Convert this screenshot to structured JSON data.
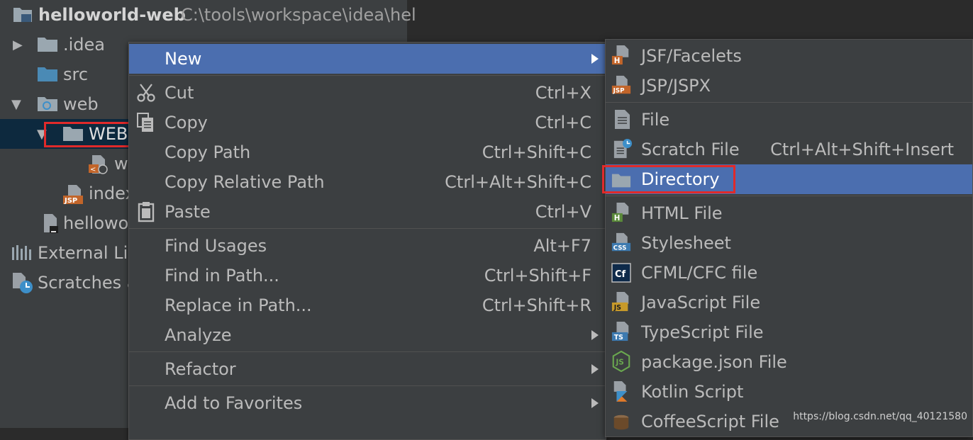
{
  "project_tree": {
    "title": "helloworld-web",
    "path": "C:\\tools\\workspace\\idea\\hel",
    "items": [
      {
        "label": ".idea"
      },
      {
        "label": "src"
      },
      {
        "label": "web"
      },
      {
        "label": "WEB-"
      },
      {
        "label": "w"
      },
      {
        "label": "index"
      },
      {
        "label": "hellowo"
      },
      {
        "label": "External Lib"
      },
      {
        "label": "Scratches a"
      }
    ]
  },
  "context_menu": {
    "items": [
      {
        "label": "New",
        "shortcut": ""
      },
      {
        "label": "Cut",
        "shortcut": "Ctrl+X"
      },
      {
        "label": "Copy",
        "shortcut": "Ctrl+C"
      },
      {
        "label": "Copy Path",
        "shortcut": "Ctrl+Shift+C"
      },
      {
        "label": "Copy Relative Path",
        "shortcut": "Ctrl+Alt+Shift+C"
      },
      {
        "label": "Paste",
        "shortcut": "Ctrl+V"
      },
      {
        "label": "Find Usages",
        "shortcut": "Alt+F7"
      },
      {
        "label": "Find in Path...",
        "shortcut": "Ctrl+Shift+F"
      },
      {
        "label": "Replace in Path...",
        "shortcut": "Ctrl+Shift+R"
      },
      {
        "label": "Analyze",
        "shortcut": ""
      },
      {
        "label": "Refactor",
        "shortcut": ""
      },
      {
        "label": "Add to Favorites",
        "shortcut": ""
      }
    ]
  },
  "new_submenu": {
    "items": [
      {
        "label": "JSF/Facelets",
        "badge": "H"
      },
      {
        "label": "JSP/JSPX",
        "badge": "JSP"
      },
      {
        "label": "File",
        "shortcut": ""
      },
      {
        "label": "Scratch File",
        "shortcut": "Ctrl+Alt+Shift+Insert"
      },
      {
        "label": "Directory",
        "shortcut": ""
      },
      {
        "label": "HTML File",
        "badge": "H"
      },
      {
        "label": "Stylesheet",
        "badge": "CSS"
      },
      {
        "label": "CFML/CFC file",
        "badge": "Cf"
      },
      {
        "label": "JavaScript File",
        "badge": "JS"
      },
      {
        "label": "TypeScript File",
        "badge": "TS"
      },
      {
        "label": "package.json File",
        "badge": "JS"
      },
      {
        "label": "Kotlin Script",
        "badge": ""
      },
      {
        "label": "CoffeeScript File",
        "badge": ""
      }
    ]
  },
  "watermark": "https://blog.csdn.net/qq_40121580",
  "colors": {
    "highlight": "#4b6eaf",
    "panel": "#3c3f41",
    "annotation_red": "#e02a2a"
  }
}
